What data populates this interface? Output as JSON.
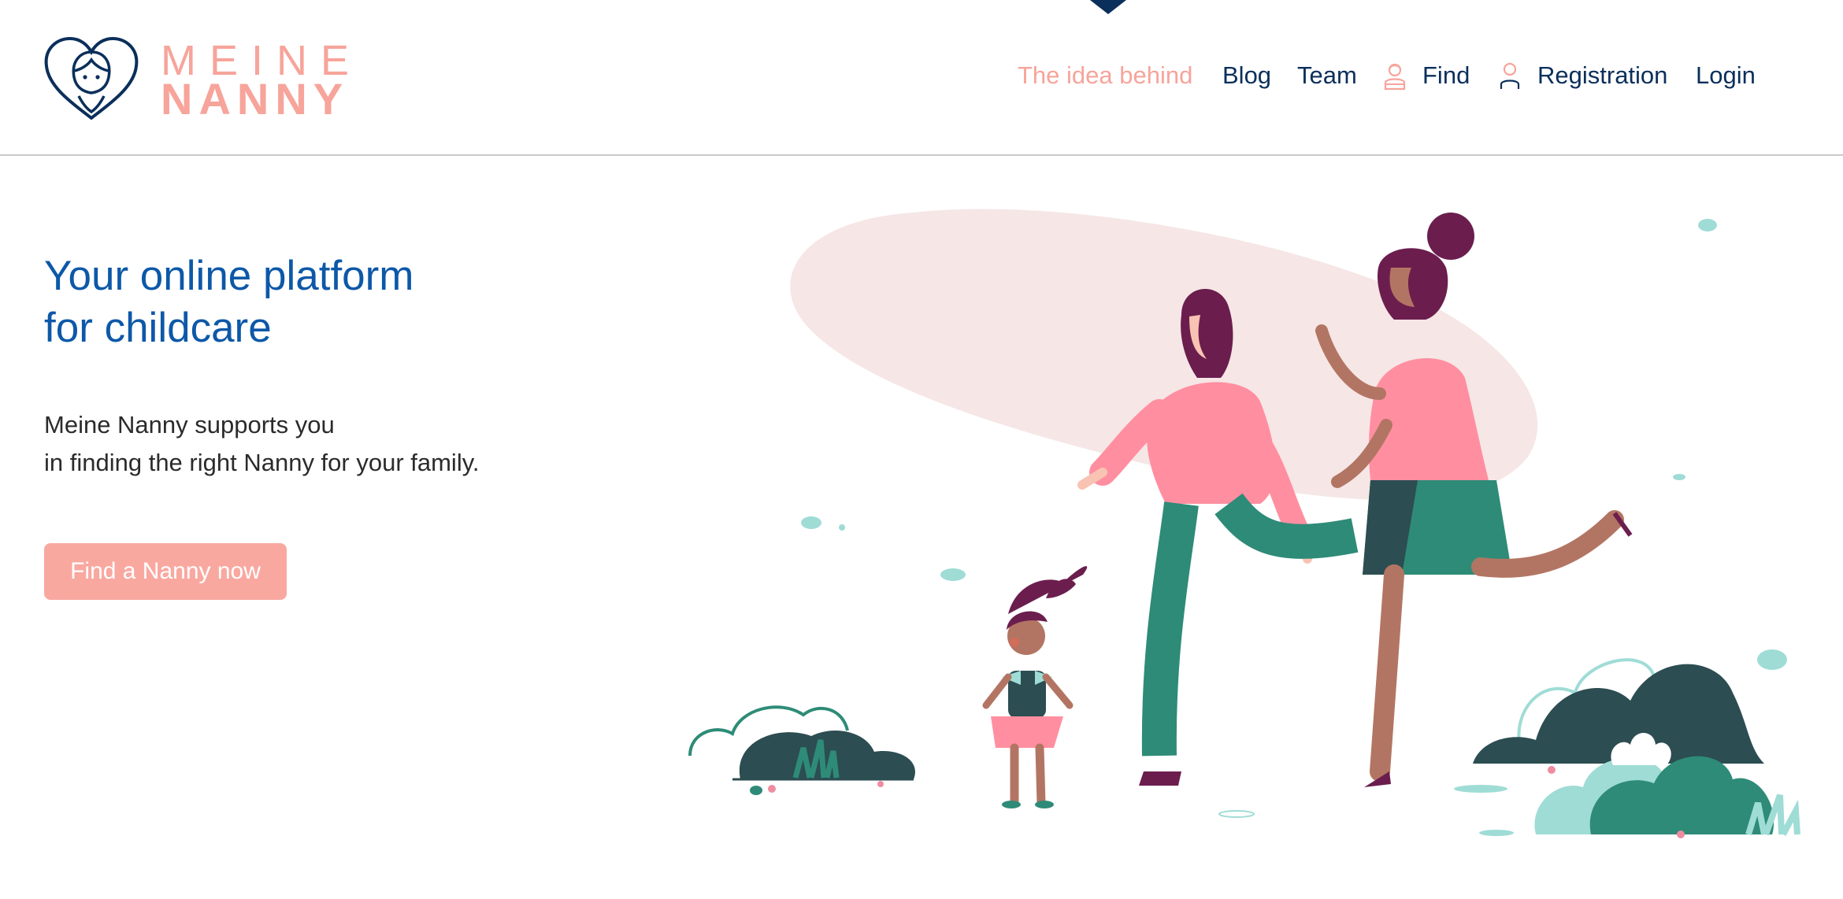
{
  "brand": {
    "line1": "MEINE",
    "line2": "NANNY"
  },
  "nav": {
    "items": [
      {
        "label": "The idea behind",
        "active": true
      },
      {
        "label": "Blog",
        "active": false
      },
      {
        "label": "Team",
        "active": false
      },
      {
        "label": "Find",
        "active": false,
        "icon": "nanny-person-icon"
      },
      {
        "label": "Registration",
        "active": false,
        "icon": "user-icon"
      },
      {
        "label": "Login",
        "active": false
      }
    ]
  },
  "hero": {
    "title_line1": "Your online platform",
    "title_line2": "for childcare",
    "text_line1": "Meine Nanny supports you",
    "text_line2": "in finding the right Nanny for your family.",
    "cta_label": "Find a Nanny now"
  },
  "colors": {
    "brand_pink": "#f7a49b",
    "navy": "#0b2f5b",
    "title_blue": "#0d58a8",
    "cta_bg": "#f9a8a0"
  }
}
